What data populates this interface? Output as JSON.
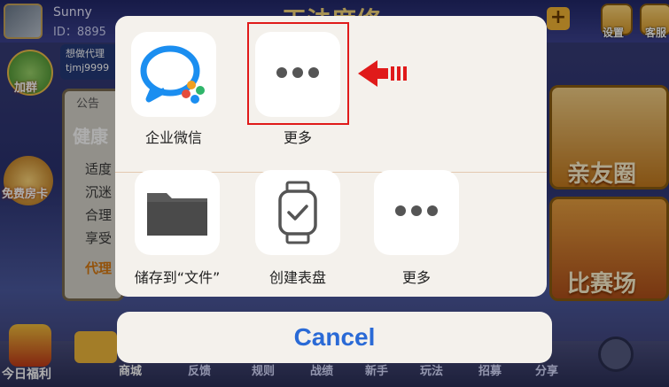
{
  "background": {
    "user": {
      "name": "Sunny",
      "id": "ID：8895"
    },
    "title_fragment": "王法度修",
    "settings_label": "设置",
    "service_label": "客服",
    "left_badges": {
      "add_friend": "加群",
      "free_card": "免费房卡"
    },
    "tip": {
      "line1": "想做代理",
      "line2": "tjmj9999"
    },
    "notice": {
      "header": "公告",
      "title": "健康",
      "rows": [
        "适度",
        "沉迷",
        "合理",
        "享受"
      ],
      "footer": "代理"
    },
    "cards": {
      "friends": "亲友圈",
      "match": "比赛场"
    },
    "bottom": {
      "welfare": "今日福利",
      "shop": "商城",
      "items": [
        "反馈",
        "规则",
        "战绩",
        "新手",
        "玩法",
        "招募",
        "分享"
      ]
    }
  },
  "share_sheet": {
    "apps": [
      {
        "label": "企业微信",
        "icon": "wecom-icon"
      },
      {
        "label": "更多",
        "icon": "more-dots-icon"
      }
    ],
    "actions": [
      {
        "label": "储存到“文件”",
        "icon": "folder-icon"
      },
      {
        "label": "创建表盘",
        "icon": "watch-face-icon"
      },
      {
        "label": "更多",
        "icon": "more-dots-icon"
      }
    ],
    "cancel_label": "Cancel"
  },
  "colors": {
    "highlight": "#e01a1a",
    "cancel_text": "#2a6ad6",
    "sheet_bg": "#f4f1ec"
  }
}
